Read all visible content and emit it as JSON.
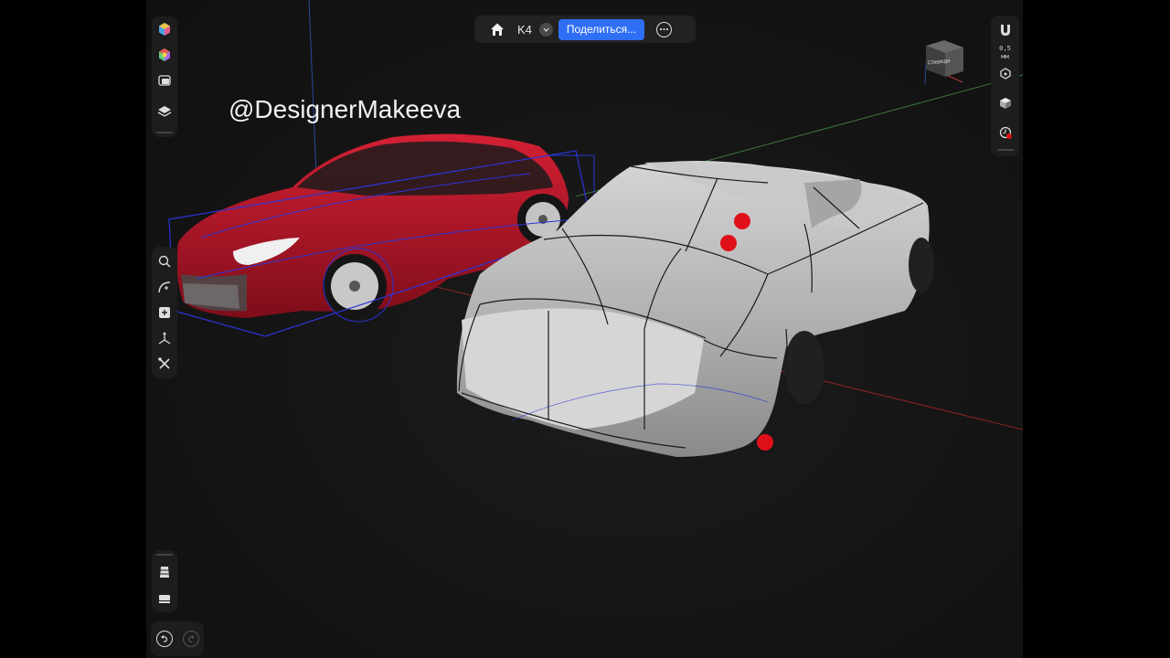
{
  "watermark": "@DesignerMakeeva",
  "topbar": {
    "home_icon": "home-icon",
    "doc_name": "K4",
    "share_label": "Поделиться...",
    "more_icon": "ellipsis-icon"
  },
  "left_toolbar": {
    "top_tools": [
      "colored-cube-icon",
      "material-sphere-icon",
      "image-import-icon",
      "layers-icon"
    ],
    "middle_tools": [
      "search-icon",
      "curve-tool-icon",
      "add-primitive-icon",
      "transform-gizmo-icon",
      "modify-tools-icon"
    ],
    "bottom_tools": [
      "subdivision-icon",
      "measure-icon"
    ]
  },
  "right_panel": {
    "snap_value": "0,5",
    "snap_unit": "мм",
    "tools": [
      "magnet-icon",
      "pivot-icon",
      "shading-cube-icon",
      "history-clock-icon"
    ]
  },
  "history": {
    "undo_icon": "undo-icon",
    "redo_icon": "redo-icon"
  },
  "nav_cube": {
    "face_label": "Спереди"
  },
  "colors": {
    "accent": "#2f6ff5",
    "control_point": "#e0101a",
    "car_red": "#c0182a",
    "clay_surface": "#b9b9b9",
    "wireframe": "#2a35d8"
  }
}
